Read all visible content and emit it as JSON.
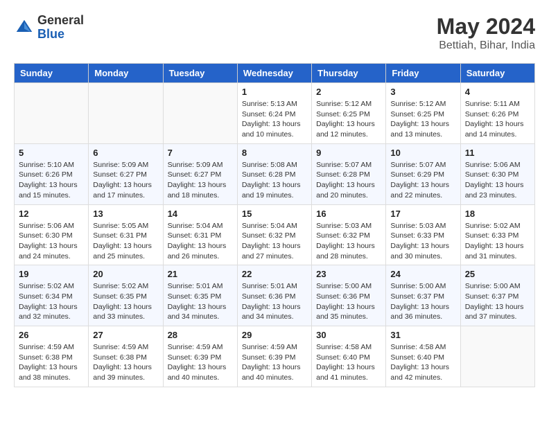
{
  "header": {
    "logo_general": "General",
    "logo_blue": "Blue",
    "month_year": "May 2024",
    "location": "Bettiah, Bihar, India"
  },
  "weekdays": [
    "Sunday",
    "Monday",
    "Tuesday",
    "Wednesday",
    "Thursday",
    "Friday",
    "Saturday"
  ],
  "weeks": [
    [
      {
        "day": "",
        "info": ""
      },
      {
        "day": "",
        "info": ""
      },
      {
        "day": "",
        "info": ""
      },
      {
        "day": "1",
        "info": "Sunrise: 5:13 AM\nSunset: 6:24 PM\nDaylight: 13 hours\nand 10 minutes."
      },
      {
        "day": "2",
        "info": "Sunrise: 5:12 AM\nSunset: 6:25 PM\nDaylight: 13 hours\nand 12 minutes."
      },
      {
        "day": "3",
        "info": "Sunrise: 5:12 AM\nSunset: 6:25 PM\nDaylight: 13 hours\nand 13 minutes."
      },
      {
        "day": "4",
        "info": "Sunrise: 5:11 AM\nSunset: 6:26 PM\nDaylight: 13 hours\nand 14 minutes."
      }
    ],
    [
      {
        "day": "5",
        "info": "Sunrise: 5:10 AM\nSunset: 6:26 PM\nDaylight: 13 hours\nand 15 minutes."
      },
      {
        "day": "6",
        "info": "Sunrise: 5:09 AM\nSunset: 6:27 PM\nDaylight: 13 hours\nand 17 minutes."
      },
      {
        "day": "7",
        "info": "Sunrise: 5:09 AM\nSunset: 6:27 PM\nDaylight: 13 hours\nand 18 minutes."
      },
      {
        "day": "8",
        "info": "Sunrise: 5:08 AM\nSunset: 6:28 PM\nDaylight: 13 hours\nand 19 minutes."
      },
      {
        "day": "9",
        "info": "Sunrise: 5:07 AM\nSunset: 6:28 PM\nDaylight: 13 hours\nand 20 minutes."
      },
      {
        "day": "10",
        "info": "Sunrise: 5:07 AM\nSunset: 6:29 PM\nDaylight: 13 hours\nand 22 minutes."
      },
      {
        "day": "11",
        "info": "Sunrise: 5:06 AM\nSunset: 6:30 PM\nDaylight: 13 hours\nand 23 minutes."
      }
    ],
    [
      {
        "day": "12",
        "info": "Sunrise: 5:06 AM\nSunset: 6:30 PM\nDaylight: 13 hours\nand 24 minutes."
      },
      {
        "day": "13",
        "info": "Sunrise: 5:05 AM\nSunset: 6:31 PM\nDaylight: 13 hours\nand 25 minutes."
      },
      {
        "day": "14",
        "info": "Sunrise: 5:04 AM\nSunset: 6:31 PM\nDaylight: 13 hours\nand 26 minutes."
      },
      {
        "day": "15",
        "info": "Sunrise: 5:04 AM\nSunset: 6:32 PM\nDaylight: 13 hours\nand 27 minutes."
      },
      {
        "day": "16",
        "info": "Sunrise: 5:03 AM\nSunset: 6:32 PM\nDaylight: 13 hours\nand 28 minutes."
      },
      {
        "day": "17",
        "info": "Sunrise: 5:03 AM\nSunset: 6:33 PM\nDaylight: 13 hours\nand 30 minutes."
      },
      {
        "day": "18",
        "info": "Sunrise: 5:02 AM\nSunset: 6:33 PM\nDaylight: 13 hours\nand 31 minutes."
      }
    ],
    [
      {
        "day": "19",
        "info": "Sunrise: 5:02 AM\nSunset: 6:34 PM\nDaylight: 13 hours\nand 32 minutes."
      },
      {
        "day": "20",
        "info": "Sunrise: 5:02 AM\nSunset: 6:35 PM\nDaylight: 13 hours\nand 33 minutes."
      },
      {
        "day": "21",
        "info": "Sunrise: 5:01 AM\nSunset: 6:35 PM\nDaylight: 13 hours\nand 34 minutes."
      },
      {
        "day": "22",
        "info": "Sunrise: 5:01 AM\nSunset: 6:36 PM\nDaylight: 13 hours\nand 34 minutes."
      },
      {
        "day": "23",
        "info": "Sunrise: 5:00 AM\nSunset: 6:36 PM\nDaylight: 13 hours\nand 35 minutes."
      },
      {
        "day": "24",
        "info": "Sunrise: 5:00 AM\nSunset: 6:37 PM\nDaylight: 13 hours\nand 36 minutes."
      },
      {
        "day": "25",
        "info": "Sunrise: 5:00 AM\nSunset: 6:37 PM\nDaylight: 13 hours\nand 37 minutes."
      }
    ],
    [
      {
        "day": "26",
        "info": "Sunrise: 4:59 AM\nSunset: 6:38 PM\nDaylight: 13 hours\nand 38 minutes."
      },
      {
        "day": "27",
        "info": "Sunrise: 4:59 AM\nSunset: 6:38 PM\nDaylight: 13 hours\nand 39 minutes."
      },
      {
        "day": "28",
        "info": "Sunrise: 4:59 AM\nSunset: 6:39 PM\nDaylight: 13 hours\nand 40 minutes."
      },
      {
        "day": "29",
        "info": "Sunrise: 4:59 AM\nSunset: 6:39 PM\nDaylight: 13 hours\nand 40 minutes."
      },
      {
        "day": "30",
        "info": "Sunrise: 4:58 AM\nSunset: 6:40 PM\nDaylight: 13 hours\nand 41 minutes."
      },
      {
        "day": "31",
        "info": "Sunrise: 4:58 AM\nSunset: 6:40 PM\nDaylight: 13 hours\nand 42 minutes."
      },
      {
        "day": "",
        "info": ""
      }
    ]
  ]
}
